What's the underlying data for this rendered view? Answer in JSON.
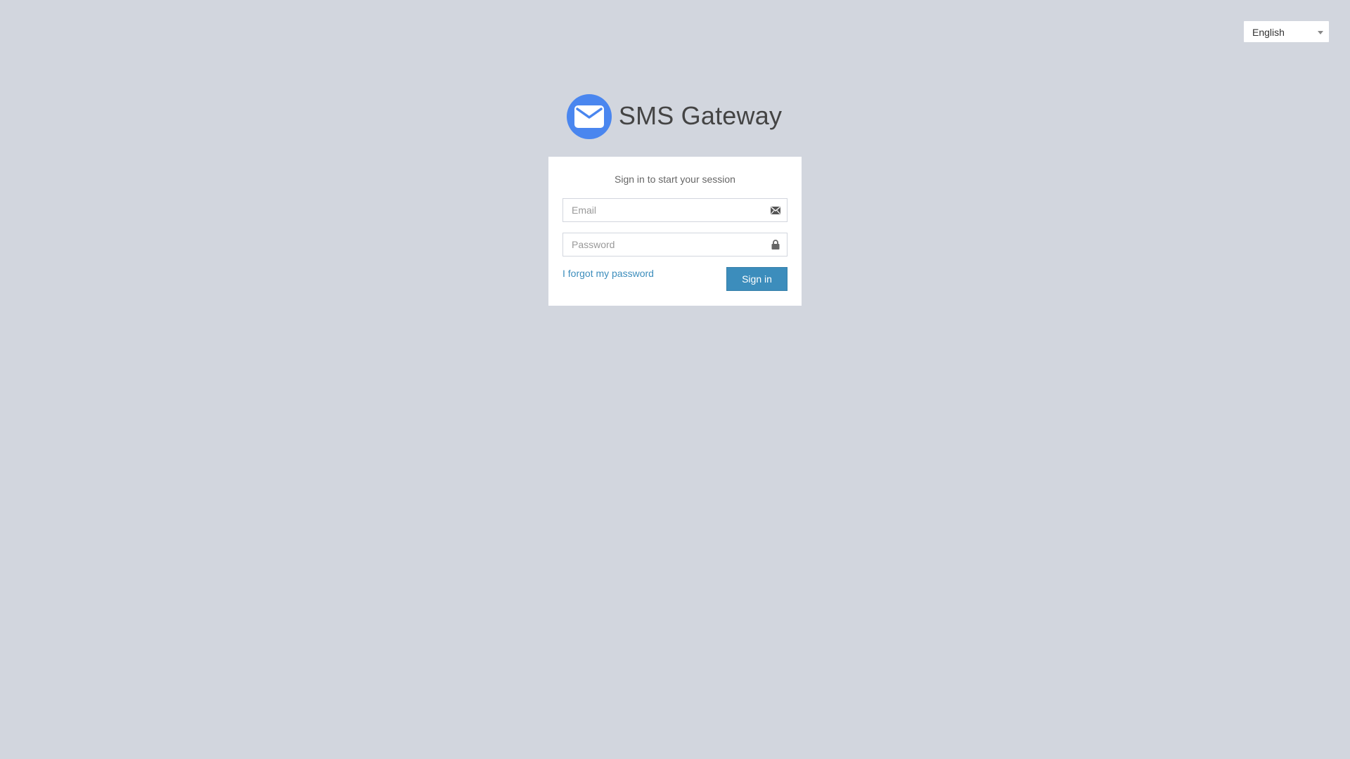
{
  "language_selector": {
    "selected": "English",
    "icon": "chevron-down-icon"
  },
  "header": {
    "app_title": "SMS Gateway",
    "logo_icon": "envelope-icon",
    "logo_color": "#4a86ef"
  },
  "login": {
    "message": "Sign in to start your session",
    "email": {
      "placeholder": "Email",
      "value": "",
      "icon": "envelope-icon"
    },
    "password": {
      "placeholder": "Password",
      "value": "",
      "icon": "lock-icon"
    },
    "forgot_link": "I forgot my password",
    "submit_label": "Sign in"
  },
  "colors": {
    "background": "#d2d6de",
    "accent": "#3c8dbc",
    "card": "#ffffff"
  }
}
